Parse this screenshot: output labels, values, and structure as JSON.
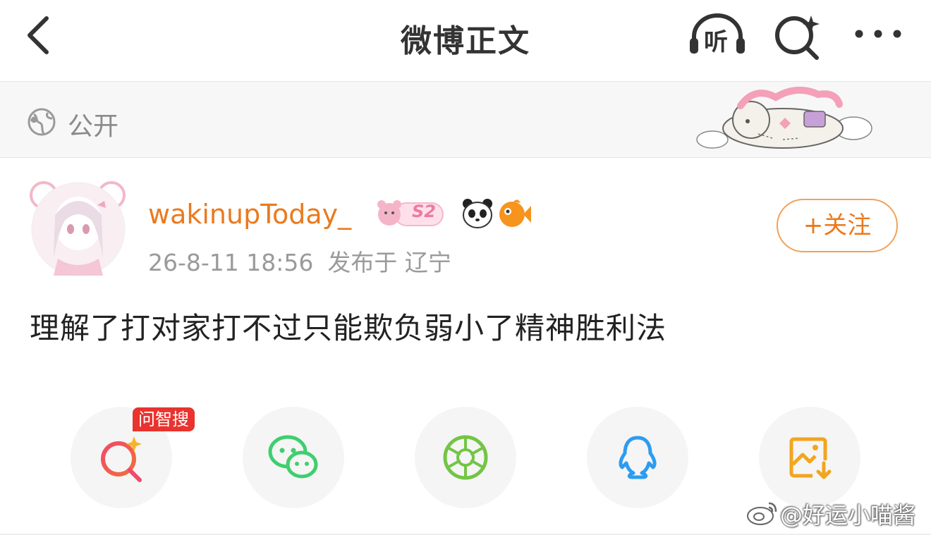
{
  "nav": {
    "title": "微博正文",
    "listen_label": "听"
  },
  "visibility": {
    "label": "公开"
  },
  "post": {
    "username": "wakinupToday_",
    "badge_text": "S2",
    "date": "26-8-11 18:56",
    "location": "发布于 辽宁",
    "follow_label": "+关注",
    "content": "理解了打对家打不过只能欺负弱小了精神胜利法"
  },
  "share": {
    "ai_tag": "问智搜"
  },
  "watermark": {
    "text": "@好运小喵酱"
  },
  "colors": {
    "accent": "#ea7a1e",
    "follow_border": "#f1a15a",
    "ai_tag": "#e8332e",
    "wechat": "#3ecf6e",
    "moments": "#73c544",
    "qq": "#2d9cf0",
    "save": "#f2a51f"
  },
  "icons": [
    "back-arrow-icon",
    "headphones-icon",
    "ai-search-icon",
    "more-icon",
    "globe-icon",
    "wechat-icon",
    "moments-icon",
    "qq-icon",
    "save-image-icon",
    "weibo-logo-icon"
  ]
}
